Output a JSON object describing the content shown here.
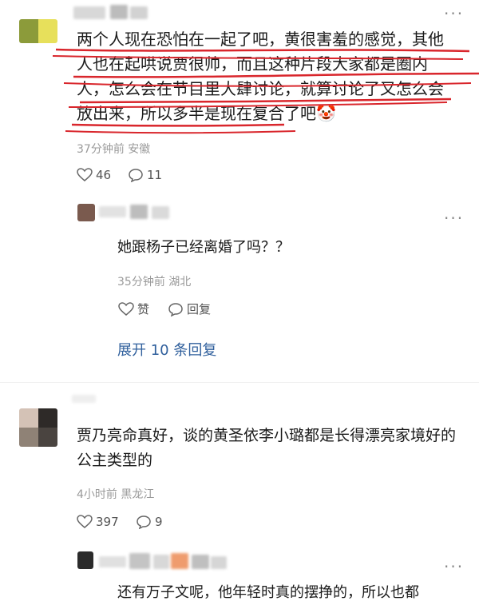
{
  "comments": [
    {
      "text": "两个人现在恐怕在一起了吧，黄很害羞的感觉，其他人也在起哄说贾很帅，而且这种片段大家都是圈内人，怎么会在节目里大肆讨论，就算讨论了又怎么会放出来，所以多半是现在复合了吧🤡",
      "meta": "37分钟前 安徽",
      "likes": "46",
      "replies": "11"
    },
    {
      "text": "她跟杨子已经离婚了吗？？",
      "meta": "35分钟前 湖北",
      "like_label": "赞",
      "reply_label": "回复",
      "expand_label": "展开 10 条回复"
    },
    {
      "text": "贾乃亮命真好，谈的黄圣依李小璐都是长得漂亮家境好的公主类型的",
      "meta": "4小时前 黑龙江",
      "likes": "397",
      "replies": "9"
    },
    {
      "text": "还有万子文呢，他年轻时真的摆挣的，所以也都"
    }
  ]
}
